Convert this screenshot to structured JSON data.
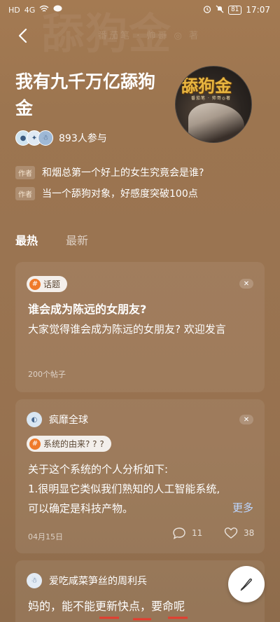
{
  "status_bar": {
    "left_icons": [
      "HD",
      "4G",
      "wifi",
      "message"
    ],
    "battery": "81",
    "time": "17:07"
  },
  "header": {
    "back_icon": "back-chevron-icon",
    "watermark": "舔狗金",
    "watermark_sub": "番茄笔 · 帅哥 ◎ 著"
  },
  "topic": {
    "title": "我有九千万亿舔狗金",
    "cover_title": "舔狗金",
    "cover_sub": "番茄笔 · 帅哥◎著",
    "participants": "893人参与",
    "author_tag": "作者",
    "author_lines": [
      "和烟总第一个好上的女生究竟会是谁?",
      "当一个舔狗对象，好感度突破100点"
    ]
  },
  "tabs": [
    {
      "label": "最热",
      "active": true
    },
    {
      "label": "最新",
      "active": false
    }
  ],
  "cards": [
    {
      "chip": "话题",
      "heading": "谁会成为陈远的女朋友?",
      "body": "大家觉得谁会成为陈远的女朋友? 欢迎发言",
      "meta": "200个帖子"
    },
    {
      "user": "疯靡全球",
      "chip": "系统的由来? ? ?",
      "body_lines": [
        "关于这个系统的个人分析如下:",
        "1.很明显它类似我们熟知的人工智能系统,",
        "可以确定是科技产物。"
      ],
      "more": "更多",
      "date": "04月15日",
      "comments": "11",
      "likes": "38"
    },
    {
      "user": "爱吃咸菜笋丝的周利兵",
      "body": "妈的，能不能更新快点，要命呢"
    }
  ],
  "colors": {
    "background": "#9c7550",
    "chip_accent": "#ef7a2a",
    "more_link": "#bcd6ff"
  }
}
